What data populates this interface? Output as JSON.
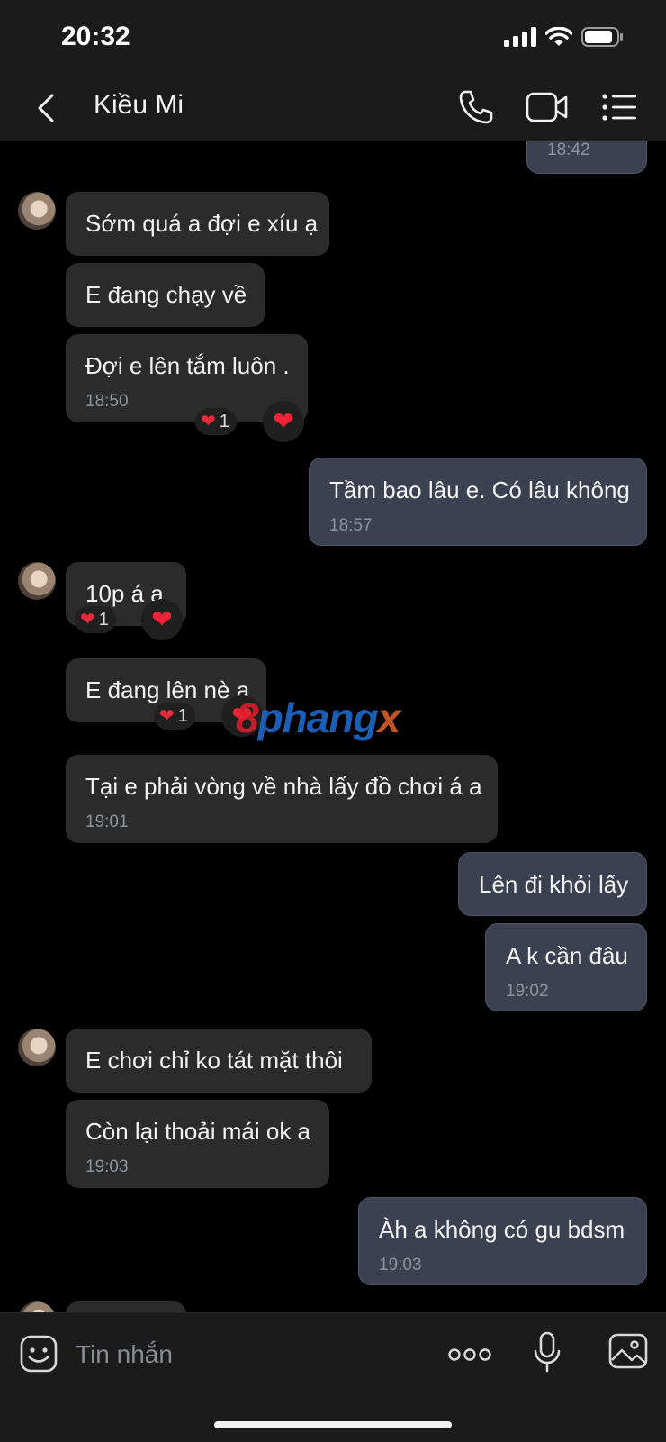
{
  "status": {
    "time": "20:32"
  },
  "header": {
    "contact_name": "Kiều Mi"
  },
  "messages": [
    {
      "dir": "out",
      "text": "",
      "time": "18:42"
    },
    {
      "dir": "in",
      "text": "Sớm quá a đợi e xíu ạ",
      "time": ""
    },
    {
      "dir": "in",
      "text": "E đang chạy về",
      "time": ""
    },
    {
      "dir": "in",
      "text": "Đợi e lên tắm luôn .",
      "time": "18:50",
      "reaction_count": "1"
    },
    {
      "dir": "out",
      "text": "Tầm bao lâu e. Có lâu không",
      "time": "18:57"
    },
    {
      "dir": "in",
      "text": "10p á a",
      "time": "",
      "reaction_count": "1"
    },
    {
      "dir": "in",
      "text": "E đang lên nè a",
      "time": "",
      "reaction_count": "1"
    },
    {
      "dir": "in",
      "text": "Tại e phải vòng về nhà lấy đồ chơi á a",
      "time": "19:01"
    },
    {
      "dir": "out",
      "text": "Lên đi khỏi lấy",
      "time": ""
    },
    {
      "dir": "out",
      "text": "A k cần đâu",
      "time": "19:02"
    },
    {
      "dir": "in",
      "text": "E chơi chỉ ko tát mặt thôi",
      "time": ""
    },
    {
      "dir": "in",
      "text": "Còn lại thoải mái ok a",
      "time": "19:03"
    },
    {
      "dir": "out",
      "text": "Àh a không có gu bdsm",
      "time": "19:03"
    }
  ],
  "watermark": {
    "part1": "8",
    "part2": "phang",
    "part3": "x"
  },
  "input": {
    "placeholder": "Tin nhắn"
  },
  "icons": {
    "back": "chevron-left-icon",
    "call": "phone-icon",
    "video": "video-camera-icon",
    "menu": "list-icon",
    "sticker": "sticker-icon",
    "more": "more-dots-icon",
    "mic": "microphone-icon",
    "image": "image-icon",
    "reaction": "heart-icon"
  },
  "colors": {
    "background": "#000000",
    "bar": "#1b1b1b",
    "incoming_bubble": "#2b2b2b",
    "outgoing_bubble": "#3b4150",
    "heart": "#e52b3a"
  }
}
